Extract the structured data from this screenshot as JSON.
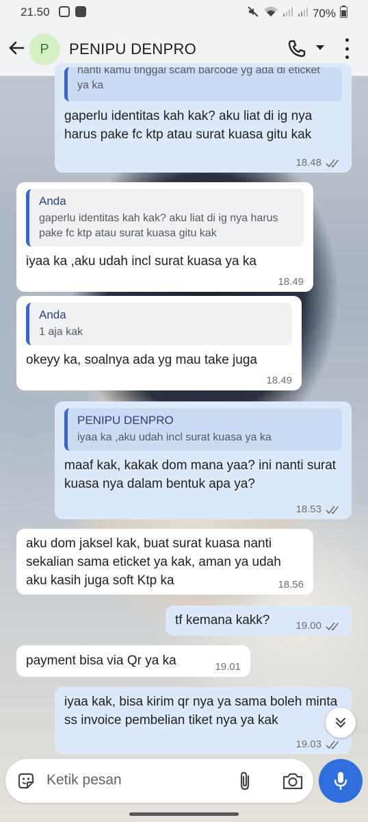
{
  "status_bar": {
    "time": "21.50",
    "battery": "70%"
  },
  "header": {
    "avatar_letter": "P",
    "contact_name": "PENIPU DENPRO"
  },
  "messages": [
    {
      "dir": "out",
      "quote_text": "nanti kamu tinggal scam barcode yg ada di eticket ya ka",
      "text": "gaperlu identitas kah kak? aku liat di ig nya harus pake fc ktp atau surat kuasa gitu kak",
      "time": "18.48"
    },
    {
      "dir": "in",
      "quote_name": "Anda",
      "quote_text": "gaperlu identitas kah kak? aku liat di ig nya harus pake fc ktp atau surat kuasa gitu kak",
      "text": "iyaa ka ,aku udah incl surat kuasa ya ka",
      "time": "18.49"
    },
    {
      "dir": "in",
      "quote_name": "Anda",
      "quote_text": "1 aja kak",
      "text": "okeyy ka, soalnya ada yg mau take juga",
      "time": "18.49"
    },
    {
      "dir": "out",
      "quote_name": "PENIPU DENPRO",
      "quote_text": "iyaa ka ,aku udah incl surat kuasa ya ka",
      "text": "maaf kak, kakak dom mana yaa? ini nanti surat kuasa nya dalam bentuk apa ya?",
      "time": "18.53"
    },
    {
      "dir": "in",
      "text": "aku dom jaksel kak, buat surat kuasa nanti sekalian sama eticket ya kak, aman ya udah aku kasih juga soft Ktp ka",
      "time": "18.56"
    },
    {
      "dir": "out",
      "text": "tf kemana kakk?",
      "time": "19.00"
    },
    {
      "dir": "in",
      "text": "payment bisa via Qr ya ka",
      "time": "19.01"
    },
    {
      "dir": "out",
      "text": "iyaa kak, bisa kirim qr nya ya sama boleh minta ss invoice pembelian tiket nya ya kak",
      "time": "19.03"
    }
  ],
  "composer": {
    "placeholder": "Ketik pesan"
  },
  "colors": {
    "outgoing_bubble": "#dbe9fb",
    "incoming_bubble": "#ffffff",
    "accent": "#2f6fdd",
    "quote_bar": "#3b63c9"
  }
}
